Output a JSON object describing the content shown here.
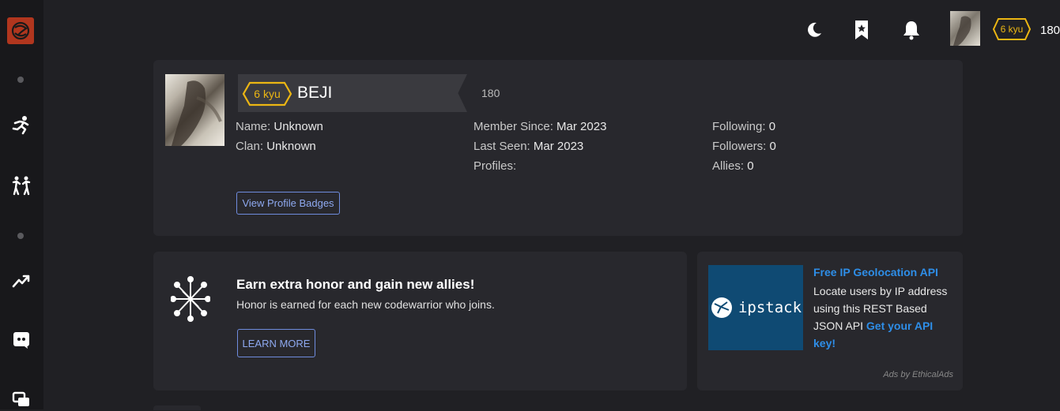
{
  "topbar": {
    "theme_icon": "moon-icon",
    "bookmark_icon": "bookmark-star-icon",
    "notifications_icon": "bell-icon",
    "rank": "6 kyu",
    "honor": "180"
  },
  "sidebar": {
    "icons": [
      "codewars-logo",
      "practice-icon",
      "kumite-icon",
      "leaderboard-icon",
      "discord-icon",
      "forum-icon"
    ]
  },
  "profile": {
    "rank": "6 kyu",
    "username": "BEJI",
    "honor": "180",
    "name_label": "Name:",
    "name_value": "Unknown",
    "clan_label": "Clan:",
    "clan_value": "Unknown",
    "member_since_label": "Member Since:",
    "member_since_value": "Mar 2023",
    "last_seen_label": "Last Seen:",
    "last_seen_value": "Mar 2023",
    "profiles_label": "Profiles:",
    "following_label": "Following:",
    "following_value": "0",
    "followers_label": "Followers:",
    "followers_value": "0",
    "allies_label": "Allies:",
    "allies_value": "0",
    "badges_button": "View Profile Badges"
  },
  "honor_promo": {
    "title": "Earn extra honor and gain new allies!",
    "text": "Honor is earned for each new codewarrior who joins.",
    "button": "LEARN MORE"
  },
  "ad": {
    "brand": "ipstack",
    "title": "Free IP Geolocation API",
    "body": "Locate users by IP address using this REST Based JSON API",
    "link": "Get your API key!",
    "footer": "Ads by EthicalAds"
  },
  "colors": {
    "kyu_yellow": "#ecb613",
    "accent_blue": "#6f8cde",
    "ad_blue": "#0f4a73",
    "logo_red": "#b1361e"
  }
}
